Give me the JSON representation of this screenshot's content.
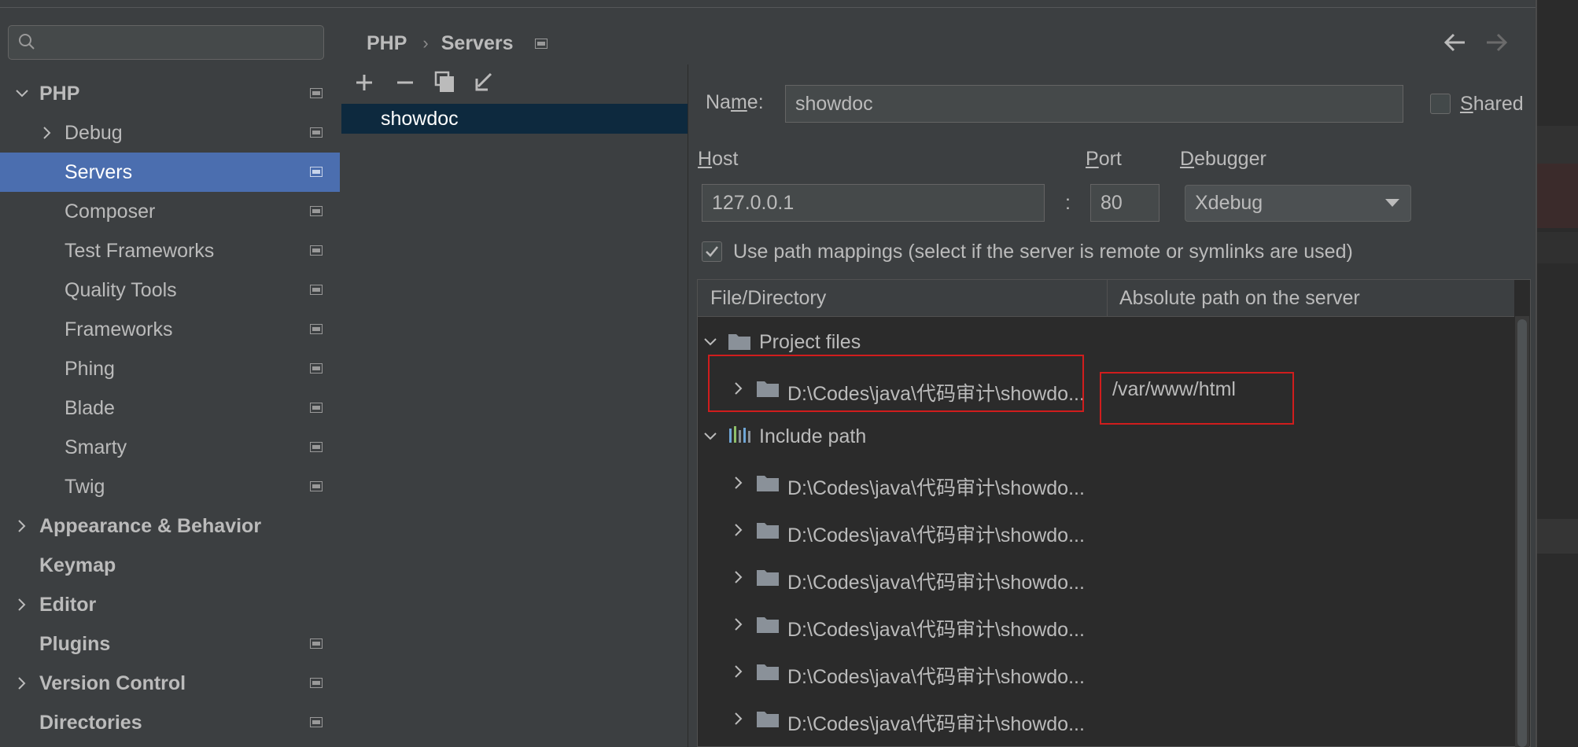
{
  "sidebar": {
    "search": {
      "placeholder": ""
    },
    "items": [
      {
        "label": "PHP",
        "bold": true,
        "expandable": "expanded"
      },
      {
        "label": "Debug",
        "bold": false,
        "expandable": "collapsed"
      },
      {
        "label": "Servers",
        "bold": false,
        "selected": true
      },
      {
        "label": "Composer"
      },
      {
        "label": "Test Frameworks"
      },
      {
        "label": "Quality Tools"
      },
      {
        "label": "Frameworks"
      },
      {
        "label": "Phing"
      },
      {
        "label": "Blade"
      },
      {
        "label": "Smarty"
      },
      {
        "label": "Twig"
      },
      {
        "label": "Appearance & Behavior",
        "bold": true,
        "expandable": "collapsed"
      },
      {
        "label": "Keymap",
        "bold": true
      },
      {
        "label": "Editor",
        "bold": true,
        "expandable": "collapsed"
      },
      {
        "label": "Plugins",
        "bold": true
      },
      {
        "label": "Version Control",
        "bold": true,
        "expandable": "collapsed"
      },
      {
        "label": "Directories",
        "bold": true
      }
    ]
  },
  "breadcrumb": {
    "parent": "PHP",
    "current": "Servers"
  },
  "servers": {
    "items": [
      "showdoc"
    ]
  },
  "form": {
    "name_label_pre": "Na",
    "name_label_u": "m",
    "name_label_post": "e:",
    "name_value": "showdoc",
    "shared_label_u": "S",
    "shared_label_rest": "hared",
    "host_label_u": "H",
    "host_label_rest": "ost",
    "host_value": "127.0.0.1",
    "colon": ":",
    "port_label_u": "P",
    "port_label_rest": "ort",
    "port_value": "80",
    "debugger_label_u": "D",
    "debugger_label_rest": "ebugger",
    "debugger_value": "Xdebug",
    "path_mappings_label": "Use path mappings (select if the server is remote or symlinks are used)",
    "path_mappings_checked": true
  },
  "mappings": {
    "col1": "File/Directory",
    "col2": "Absolute path on the server",
    "project_files": "Project files",
    "project_dir": "D:\\Codes\\java\\代码审计\\showdo...",
    "project_server_path": "/var/www/html",
    "include_path": "Include path",
    "include_dirs": [
      "D:\\Codes\\java\\代码审计\\showdo...",
      "D:\\Codes\\java\\代码审计\\showdo...",
      "D:\\Codes\\java\\代码审计\\showdo...",
      "D:\\Codes\\java\\代码审计\\showdo...",
      "D:\\Codes\\java\\代码审计\\showdo...",
      "D:\\Codes\\java\\代码审计\\showdo..."
    ]
  },
  "colors": {
    "background": "#3c3f41",
    "selection": "#4b6eaf",
    "list_selection": "#0d293e",
    "highlight_box": "#d01d1d",
    "folder": "#8a9199"
  }
}
